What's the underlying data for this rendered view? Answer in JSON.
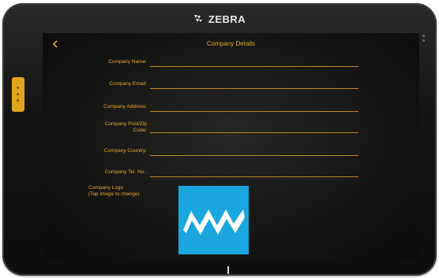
{
  "device": {
    "brand": "ZEBRA"
  },
  "header": {
    "back_icon": "chevron-left-icon",
    "title": "Company Details"
  },
  "form": {
    "fields": [
      {
        "label": "Company Name:",
        "value": ""
      },
      {
        "label": "Company Email:",
        "value": ""
      },
      {
        "label": "Company Address:",
        "value": ""
      },
      {
        "label_line1": "Company Post/Zip",
        "label_line2": "Code:",
        "value": ""
      },
      {
        "label": "Company Country:",
        "value": ""
      },
      {
        "label": "Company Tel. No.:",
        "value": ""
      }
    ],
    "logo_label_line1": "Company Logo",
    "logo_label_line2": "(Tap image to change)"
  },
  "colors": {
    "accent": "#e1ab38",
    "logo_bg": "#1aa7e0",
    "screen_bg": "#141413"
  }
}
